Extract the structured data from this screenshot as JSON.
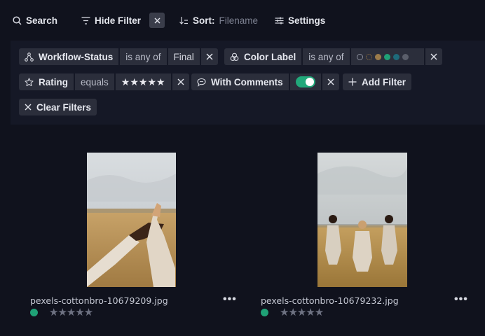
{
  "toolbar": {
    "search_label": "Search",
    "hide_filter_label": "Hide Filter",
    "sort_label": "Sort:",
    "sort_value": "Filename",
    "settings_label": "Settings"
  },
  "filters": {
    "workflow": {
      "key": "Workflow-Status",
      "op": "is any of",
      "value": "Final"
    },
    "color": {
      "key": "Color Label",
      "op": "is any of",
      "dots": [
        "#2b2e3b",
        "#8a6a3a",
        "#9b7b4a",
        "#1fa176",
        "#1e6a7a",
        "#5a5e6a"
      ]
    },
    "rating": {
      "key": "Rating",
      "op": "equals",
      "value": "★★★★★"
    },
    "comments": {
      "key": "With Comments",
      "enabled": true
    },
    "add_filter_label": "Add Filter",
    "clear_filters_label": "Clear Filters"
  },
  "assets": [
    {
      "filename": "pexels-cottonbro-10679209.jpg",
      "color_label": "#1fa176",
      "rating": "★★★★★",
      "more": "•••"
    },
    {
      "filename": "pexels-cottonbro-10679232.jpg",
      "color_label": "#1fa176",
      "rating": "★★★★★",
      "more": "•••"
    }
  ],
  "colors": {
    "background": "#10121d",
    "panel": "#151826",
    "chip": "#2b2e3b",
    "accent": "#21a87a"
  }
}
